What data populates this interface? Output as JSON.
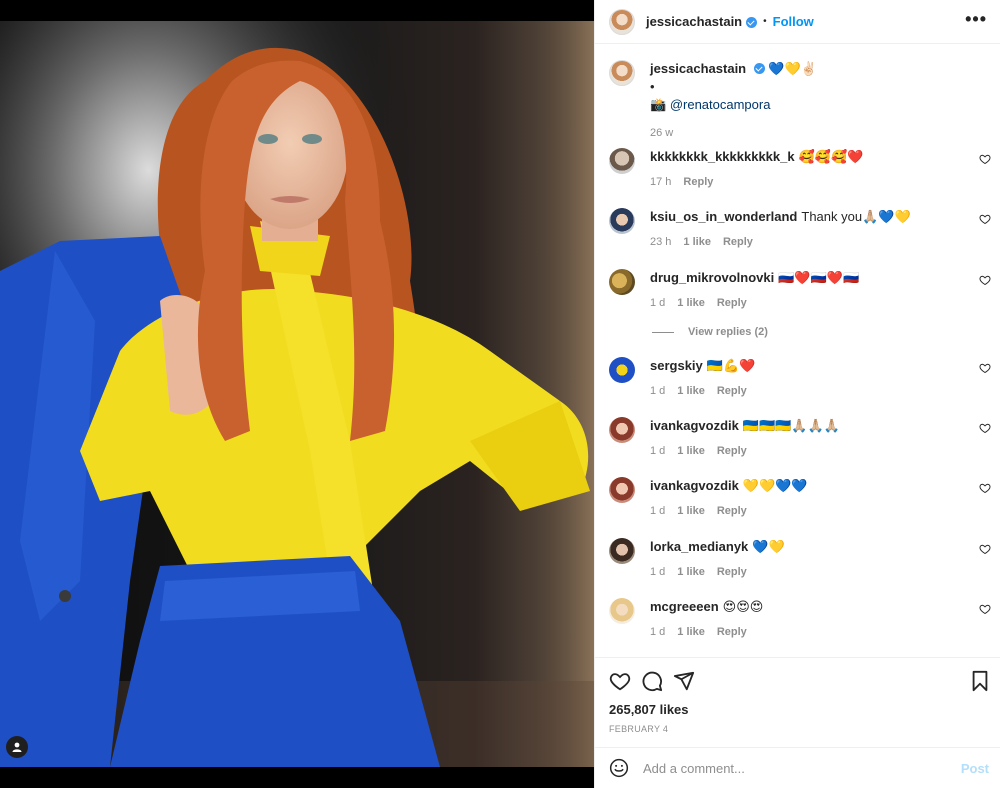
{
  "post": {
    "author": "jessicachastain",
    "follow_label": "Follow",
    "separator": "•",
    "more_label": "•••"
  },
  "caption": {
    "username": "jessicachastain",
    "text": "💙💛✌🏻",
    "dot": "•",
    "camera_emoji": "📸",
    "mention": "@renatocampora",
    "age": "26 w"
  },
  "comments": [
    {
      "username": "kkkkkkkk_kkkkkkkkk_k",
      "text": "🥰🥰🥰❤️",
      "age": "17 h",
      "likes": "",
      "reply": "Reply"
    },
    {
      "username": "ksiu_os_in_wonderland",
      "text": "Thank you🙏🏼💙💛",
      "age": "23 h",
      "likes": "1 like",
      "reply": "Reply"
    },
    {
      "username": "drug_mikrovolnovki",
      "text": "🇷🇺❤️🇷🇺❤️🇷🇺",
      "age": "1 d",
      "likes": "1 like",
      "reply": "Reply"
    },
    {
      "username": "sergskiy",
      "text": "🇺🇦💪❤️",
      "age": "1 d",
      "likes": "1 like",
      "reply": "Reply"
    },
    {
      "username": "ivankagvozdik",
      "text": "🇺🇦🇺🇦🇺🇦🙏🏼🙏🏼🙏🏼",
      "age": "1 d",
      "likes": "1 like",
      "reply": "Reply"
    },
    {
      "username": "ivankagvozdik",
      "text": "💛💛💙💙",
      "age": "1 d",
      "likes": "1 like",
      "reply": "Reply"
    },
    {
      "username": "lorka_medianyk",
      "text": "💙💛",
      "age": "1 d",
      "likes": "1 like",
      "reply": "Reply"
    },
    {
      "username": "mcgreeeen",
      "text": "😍😍😍",
      "age": "1 d",
      "likes": "1 like",
      "reply": "Reply"
    }
  ],
  "view_replies": "View replies (2)",
  "likes_count": "265,807 likes",
  "post_date": "FEBRUARY 4",
  "comment_input": {
    "placeholder": "Add a comment..."
  },
  "post_button": "Post",
  "icons": {
    "like": "heart-icon",
    "comment": "speech-bubble-icon",
    "share": "paper-plane-icon",
    "save": "bookmark-icon",
    "emoji": "smiley-icon",
    "tag": "person-icon"
  },
  "colors": {
    "accent": "#0095f6",
    "jacket_blue": "#1f4fc4",
    "blouse_yellow": "#f2dc1f",
    "hair": "#c8612e"
  }
}
